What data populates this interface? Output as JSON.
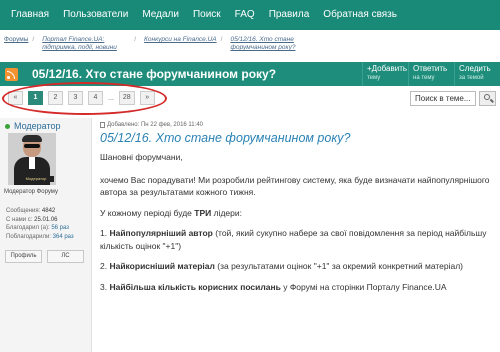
{
  "nav": [
    "Главная",
    "Пользователи",
    "Медали",
    "Поиск",
    "FAQ",
    "Правила",
    "Обратная связь"
  ],
  "breadcrumbs": [
    {
      "label": "Форумы",
      "italic": false
    },
    {
      "label": "Портал Finance.UA: підтримка, події, новини",
      "italic": true
    },
    {
      "label": "Конкурси на Finance.UA",
      "italic": true
    },
    {
      "label": "05/12/16. Хто стане форумчанином року?",
      "italic": true
    }
  ],
  "topic": {
    "title": "05/12/16. Хто стане форумчанином року?",
    "actions": [
      {
        "label": "+Добавить",
        "sub": "тему"
      },
      {
        "label": "Ответить",
        "sub": "на тему"
      },
      {
        "label": "Следить",
        "sub": "за темой"
      }
    ]
  },
  "pagination": {
    "prev": "«",
    "pages": [
      "1",
      "2",
      "3",
      "4"
    ],
    "active": "1",
    "ellipsis": "...",
    "last": "28",
    "next": "»"
  },
  "search": {
    "placeholder": "Поиск в теме..."
  },
  "post": {
    "author": "Модератор",
    "avatar_caption": "Модератор",
    "role": "Модератор Форуму",
    "stats": {
      "messages_label": "Сообщения:",
      "messages": "4842",
      "since_label": "С нами с:",
      "since": "25.01.06",
      "thanked_label": "Благодарил (а):",
      "thanked": "56 раз",
      "thanks_label": "Поблагодарили:",
      "thanks": "364 раз"
    },
    "buttons": {
      "profile": "Профиль",
      "pm": "ЛС"
    },
    "meta": "Добавлено: Пн 22 фев, 2016 11:40",
    "heading": "05/12/16. Хто стане форумчанином року?",
    "greeting": "Шановні форумчани,",
    "intro": "хочемо Вас порадувати! Ми розробили рейтингову систему, яка буде визначати найпопулярнішого автора за результатами кожного тижня.",
    "leaders_prefix": "У кожному періоді буде ",
    "leaders_bold": "ТРИ",
    "leaders_suffix": " лідери:",
    "items": [
      {
        "num": "1. ",
        "bold": "Найпопулярніший автор",
        "rest": " (той, який сукупно набере за свої повідомлення за період найбільшу кількість оцінок \"+1\")"
      },
      {
        "num": "2. ",
        "bold": "Найкорисніший матеріал",
        "rest": " (за результатами оцінок \"+1\" за окремий конкретний матеріал)"
      },
      {
        "num": "3. ",
        "bold": "Найбільша кількість корисних посилань",
        "rest": " у Форумі на сторінки Порталу Finance.UA"
      }
    ]
  },
  "colors": {
    "brand": "#1e8d7b",
    "link": "#2c6e9a",
    "heading": "#2a82b5",
    "annotation": "#d42a2a"
  }
}
